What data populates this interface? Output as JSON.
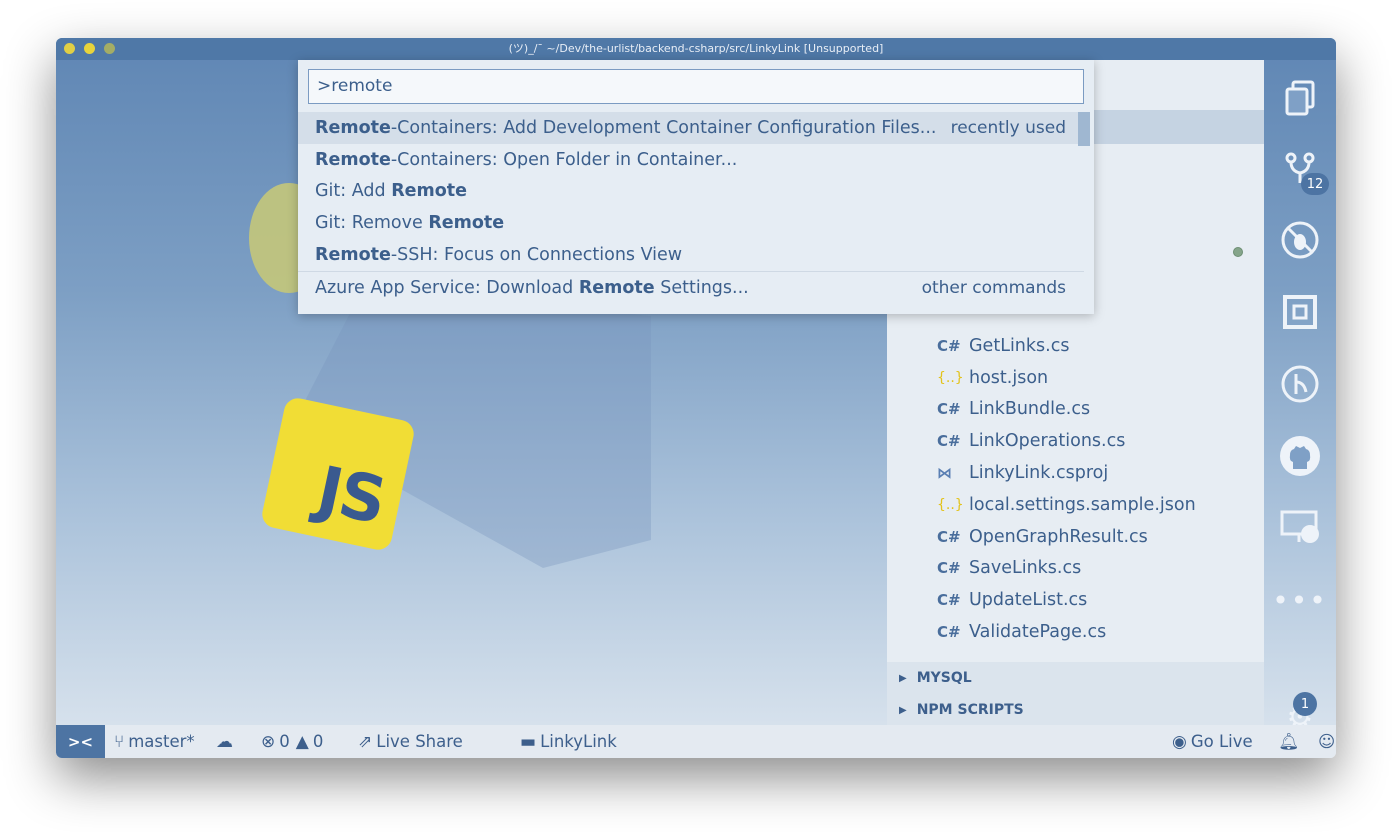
{
  "window": {
    "title": "(ツ)_/¯ ~/Dev/the-urlist/backend-csharp/src/LinkyLink [Unsupported]"
  },
  "background": {
    "js_logo_text": "JS"
  },
  "command_palette": {
    "input_value": ">remote",
    "items": [
      {
        "bold": "Remote",
        "rest": "-Containers: Add Development Container Configuration Files...",
        "hint": "recently used"
      },
      {
        "bold": "Remote",
        "rest": "-Containers: Open Folder in Container...",
        "hint": ""
      },
      {
        "prefix": "Git: Add ",
        "bold": "Remote",
        "hint": ""
      },
      {
        "prefix": "Git: Remove ",
        "bold": "Remote",
        "hint": ""
      },
      {
        "bold": "Remote",
        "rest": "-SSH: Focus on Connections View",
        "hint": ""
      },
      {
        "prefix": "Azure App Service: Download ",
        "bold": "Remote",
        "rest": " Settings...",
        "hint": "other commands"
      }
    ]
  },
  "explorer": {
    "files": [
      {
        "icon": "C#",
        "name": "GetLinks.cs"
      },
      {
        "icon": "{..}",
        "name": "host.json"
      },
      {
        "icon": "C#",
        "name": "LinkBundle.cs"
      },
      {
        "icon": "C#",
        "name": "LinkOperations.cs"
      },
      {
        "icon": "⋈",
        "name": "LinkyLink.csproj"
      },
      {
        "icon": "{..}",
        "name": "local.settings.sample.json"
      },
      {
        "icon": "C#",
        "name": "OpenGraphResult.cs"
      },
      {
        "icon": "C#",
        "name": "SaveLinks.cs"
      },
      {
        "icon": "C#",
        "name": "UpdateList.cs"
      },
      {
        "icon": "C#",
        "name": "ValidatePage.cs"
      }
    ],
    "sections": [
      "MYSQL",
      "NPM SCRIPTS"
    ]
  },
  "activity_bar": {
    "source_control_badge": "12",
    "settings_badge": "1",
    "icons": [
      "files-icon",
      "source-control-icon",
      "debug-icon",
      "extensions-icon",
      "git-graph-icon",
      "github-icon",
      "remote-explorer-icon",
      "more-icon",
      "settings-gear-icon"
    ]
  },
  "status_bar": {
    "remote_label": "><",
    "branch": "master*",
    "errors": "0",
    "warnings": "0",
    "live_share": "Live Share",
    "folder": "LinkyLink",
    "go_live": "Go Live"
  },
  "colors": {
    "accent": "#4d74a3",
    "text": "#3c5f8c",
    "js_yellow": "#f1dd35"
  }
}
